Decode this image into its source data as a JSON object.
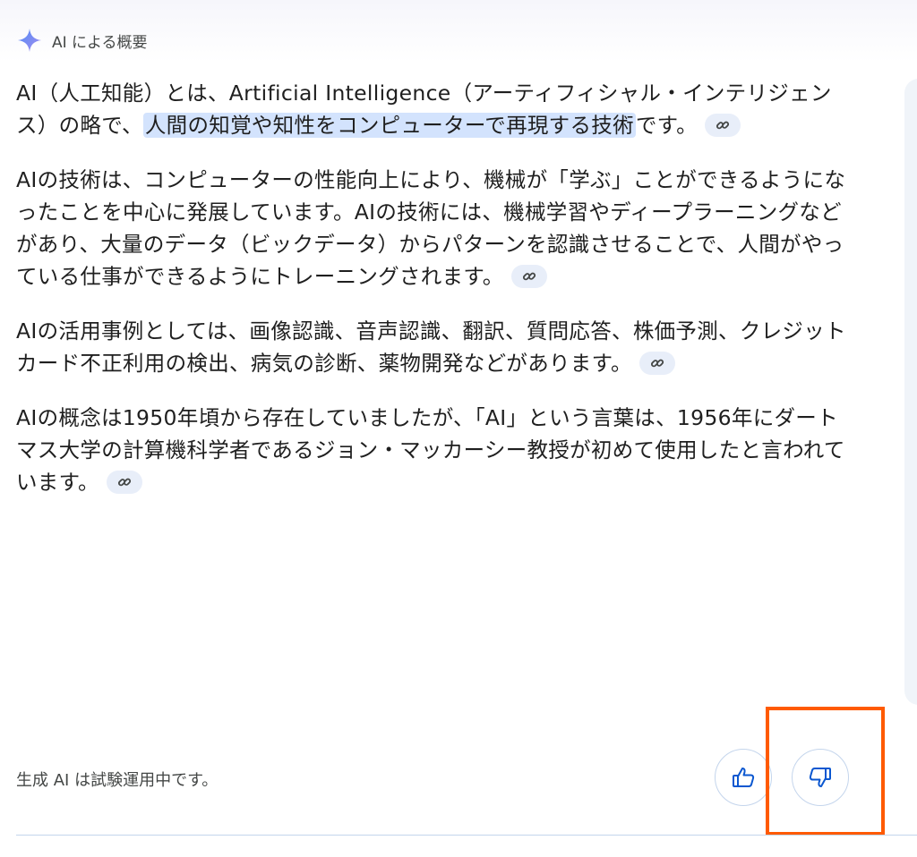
{
  "header": {
    "title": "AI による概要",
    "icon": "sparkle-icon"
  },
  "paragraphs": [
    {
      "before": "AI（人工知能）とは、Artificial Intelligence（アーティフィシャル・インテリジェンス）の略で、",
      "highlight": "人間の知覚や知性をコンピューターで再現する技術",
      "after": "です。"
    },
    {
      "before": "AIの技術は、コンピューターの性能向上により、機械が「学ぶ」ことができるようになったことを中心に発展しています。AIの技術には、機械学習やディープラーニングなどがあり、大量のデータ（ビックデータ）からパターンを認識させることで、人間がやっている仕事ができるようにトレーニングされます。",
      "highlight": "",
      "after": ""
    },
    {
      "before": "AIの活用事例としては、画像認識、音声認識、翻訳、質問応答、株価予測、クレジットカード不正利用の検出、病気の診断、薬物開発などがあります。",
      "highlight": "",
      "after": ""
    },
    {
      "before": "AIの概念は1950年頃から存在していましたが、「AI」という言葉は、1956年にダートマス大学の計算機科学者であるジョン・マッカーシー教授が初めて使用したと言われています。",
      "highlight": "",
      "after": ""
    }
  ],
  "footer": {
    "disclaimer": "生成 AI は試験運用中です。"
  },
  "feedback": {
    "thumbs_up_icon": "thumbs-up-icon",
    "thumbs_down_icon": "thumbs-down-icon",
    "accent_color": "#0b57d0",
    "focus_color": "#ff5a00"
  },
  "colors": {
    "highlight": "#d3e3fd",
    "chip": "#e8eef9",
    "text": "#1f1f1f"
  }
}
